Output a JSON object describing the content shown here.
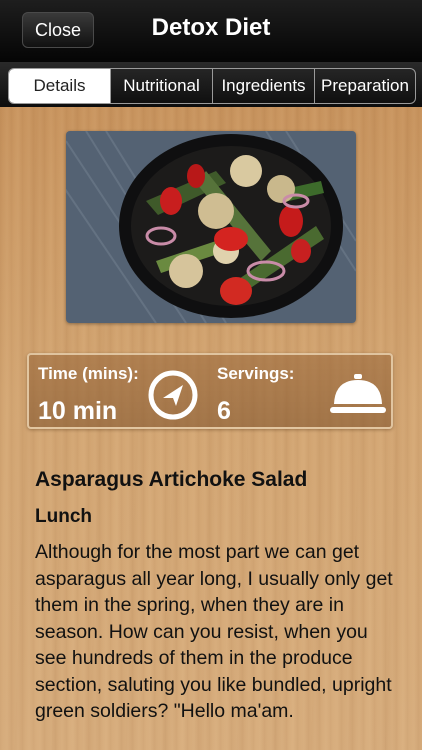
{
  "nav": {
    "close_label": "Close",
    "title": "Detox Diet"
  },
  "tabs": [
    {
      "label": "Details",
      "active": true
    },
    {
      "label": "Nutritional",
      "active": false
    },
    {
      "label": "Ingredients",
      "active": false
    },
    {
      "label": "Preparation",
      "active": false
    }
  ],
  "photo": {
    "icon": "salad-photo"
  },
  "info": {
    "time_label": "Time (mins):",
    "time_value": "10 min",
    "time_icon": "compass-icon",
    "servings_label": "Servings:",
    "servings_value": "6",
    "servings_icon": "serving-cloche-icon"
  },
  "recipe": {
    "title": "Asparagus Artichoke Salad",
    "meal_type": "Lunch",
    "description": "Although for the most part we can get asparagus all year long, I usually only get them in the spring, when they are in season. How can you resist, when you see hundreds of them in the produce section, saluting you like bundled, upright green soldiers? \"Hello ma'am."
  },
  "colors": {
    "nav_bg": "#0a0a0a",
    "wood": "#d2a574",
    "text": "#111111"
  }
}
